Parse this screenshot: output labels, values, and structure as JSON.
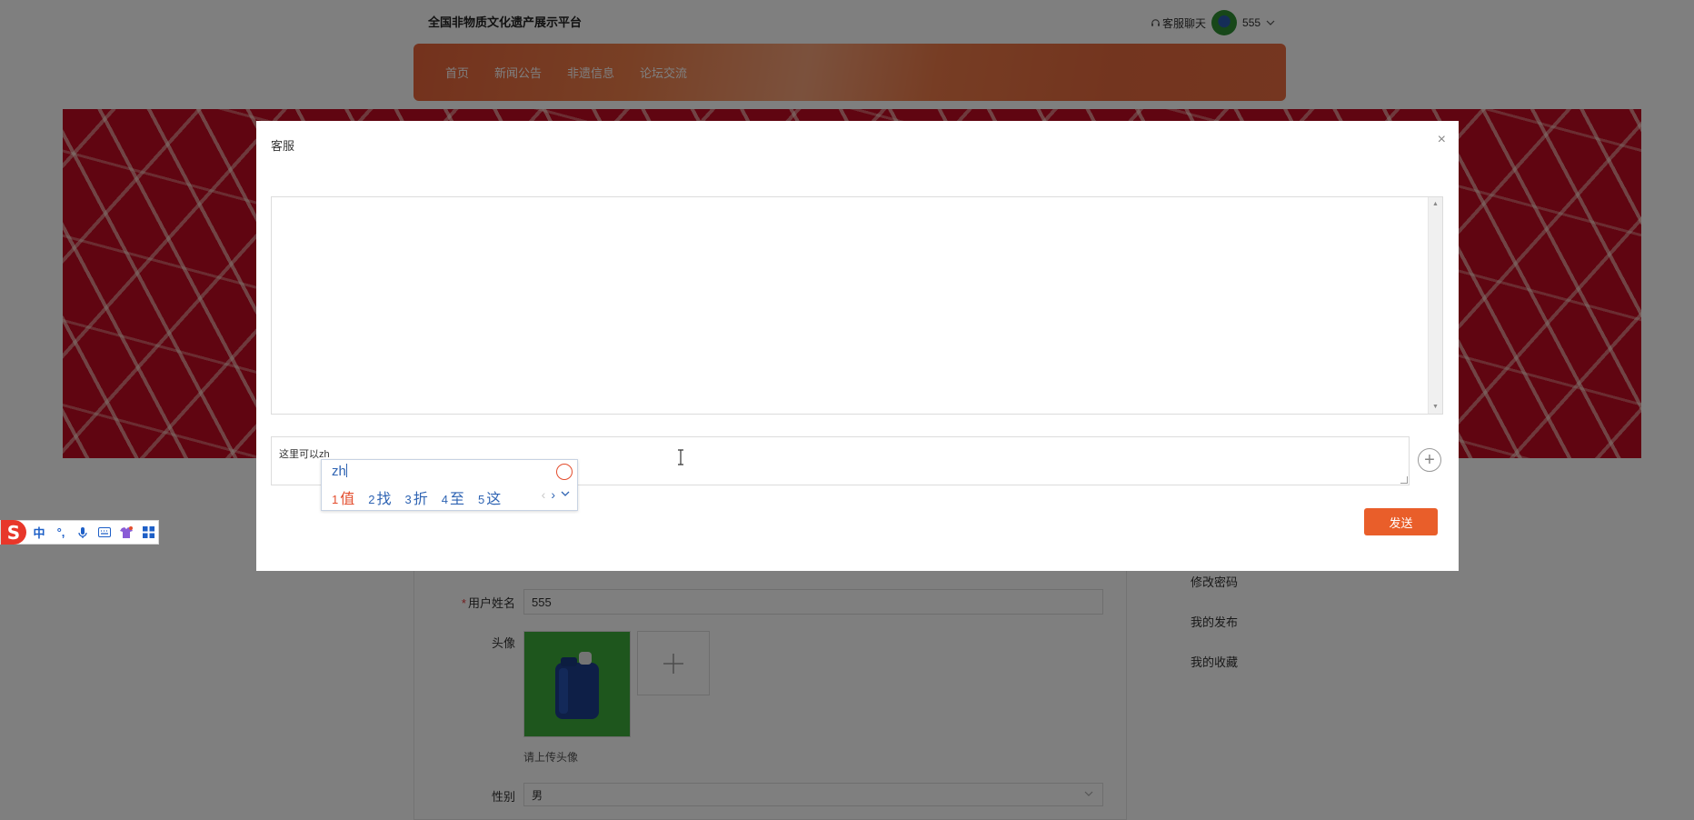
{
  "site": {
    "title": "全国非物质文化遗产展示平台",
    "chat_link": "客服聊天",
    "username": "555"
  },
  "nav": {
    "items": [
      "首页",
      "新闻公告",
      "非遗信息",
      "论坛交流"
    ]
  },
  "profile_form": {
    "username_label": "用户姓名",
    "username_value": "555",
    "avatar_label": "头像",
    "avatar_tip": "请上传头像",
    "gender_label": "性别",
    "gender_value": "男"
  },
  "side_menu": {
    "items": [
      "修改密码",
      "我的发布",
      "我的收藏"
    ]
  },
  "modal": {
    "title": "客服",
    "close_glyph": "×",
    "input_value": "这里可以zh",
    "send_label": "发送",
    "add_glyph": "+"
  },
  "ime": {
    "composition": "zh",
    "candidates": [
      {
        "num": "1",
        "text": "值"
      },
      {
        "num": "2",
        "text": "找"
      },
      {
        "num": "3",
        "text": "折"
      },
      {
        "num": "4",
        "text": "至"
      },
      {
        "num": "5",
        "text": "这"
      }
    ]
  },
  "ime_toolbar": {
    "logo": "S",
    "mode": "中",
    "punct": "°,"
  },
  "colors": {
    "accent": "#e95e2a",
    "nav_gradient_main": "#e8643a",
    "banner_red": "#c10a22",
    "ime_blue": "#2f64b3",
    "ime_first_red": "#e34d2d"
  }
}
